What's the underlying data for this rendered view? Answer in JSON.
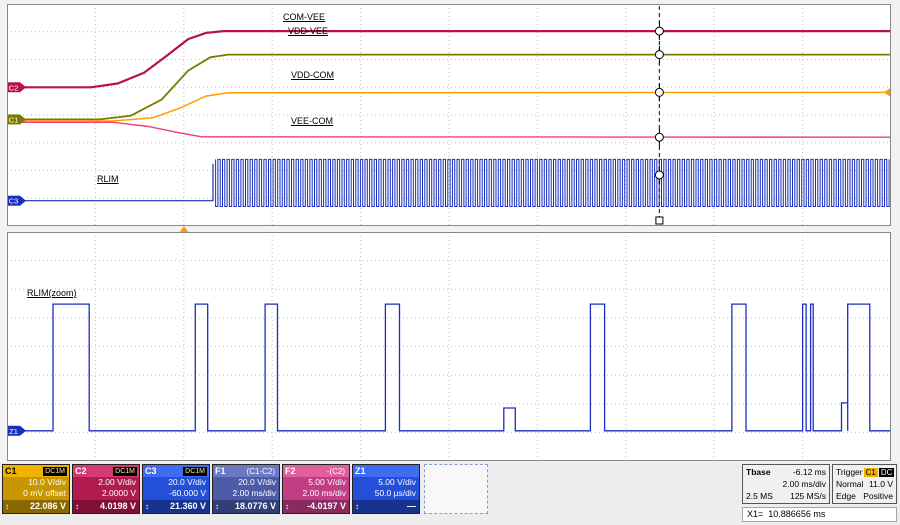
{
  "trace_labels": {
    "top": [
      {
        "text": "COM-VEE",
        "x": 276,
        "y": 8
      },
      {
        "text": "VDD-VEE",
        "x": 281,
        "y": 22
      },
      {
        "text": "VDD-COM",
        "x": 284,
        "y": 66
      },
      {
        "text": "VEE-COM",
        "x": 284,
        "y": 112
      },
      {
        "text": "RLIM",
        "x": 90,
        "y": 170
      }
    ],
    "bottom": [
      {
        "text": "RLIM(zoom)",
        "x": 20,
        "y": 56
      }
    ]
  },
  "chart_data": [
    {
      "type": "line",
      "title": "Main graticule: power rails and RLIM switching",
      "divx": 10,
      "divy": 8,
      "x_units": "time, 2.00 ms/div",
      "trigger_x": 0.2,
      "series": [
        {
          "name": "COM-VEE",
          "color": "#b8124a",
          "width": 2.2,
          "points": [
            [
              0,
              0.375
            ],
            [
              0.095,
              0.375
            ],
            [
              0.125,
              0.358
            ],
            [
              0.155,
              0.31
            ],
            [
              0.18,
              0.235
            ],
            [
              0.205,
              0.158
            ],
            [
              0.225,
              0.13
            ],
            [
              0.245,
              0.122
            ],
            [
              1,
              0.122
            ]
          ]
        },
        {
          "name": "VDD-VEE",
          "color": "#7d7a00",
          "width": 1.8,
          "points": [
            [
              0,
              0.52
            ],
            [
              0.105,
              0.52
            ],
            [
              0.14,
              0.503
            ],
            [
              0.175,
              0.43
            ],
            [
              0.205,
              0.3
            ],
            [
              0.23,
              0.24
            ],
            [
              0.25,
              0.228
            ],
            [
              1,
              0.228
            ]
          ]
        },
        {
          "name": "VDD-COM",
          "color": "#ff9c00",
          "width": 1.5,
          "points": [
            [
              0,
              0.527
            ],
            [
              0.12,
              0.527
            ],
            [
              0.165,
              0.512
            ],
            [
              0.195,
              0.47
            ],
            [
              0.225,
              0.415
            ],
            [
              0.25,
              0.4
            ],
            [
              1,
              0.398
            ]
          ]
        },
        {
          "name": "VEE-COM",
          "color": "#f04070",
          "width": 1.4,
          "points": [
            [
              0,
              0.533
            ],
            [
              0.12,
              0.533
            ],
            [
              0.16,
              0.552
            ],
            [
              0.195,
              0.58
            ],
            [
              0.22,
              0.598
            ],
            [
              1,
              0.6
            ]
          ]
        },
        {
          "name": "RLIM-baseline",
          "color": "#1a2ec0",
          "width": 1.2,
          "points": [
            [
              0,
              0.886
            ],
            [
              0.233,
              0.886
            ],
            [
              0.233,
              0.72
            ]
          ]
        }
      ],
      "pwm": {
        "name": "RLIM",
        "color": "#1a2ec0",
        "x0": 0.236,
        "x1": 1.0,
        "top": 0.7,
        "bottom": 0.912,
        "step": 0.0026
      },
      "cursor": {
        "x": 0.738,
        "color": "#333",
        "markers": [
          0.122,
          0.228,
          0.398,
          0.6,
          0.77
        ],
        "bottom_square": true
      },
      "left_markers": [
        {
          "label": "C2",
          "color": "#b8124a",
          "y": 0.375
        },
        {
          "label": "C1",
          "color": "#7d7a00",
          "y": 0.52
        },
        {
          "label": "C3",
          "color": "#1a2ec0",
          "y": 0.886
        }
      ],
      "right_markers": [
        {
          "label": "",
          "color": "#ff9c00",
          "y": 0.398
        }
      ]
    },
    {
      "type": "pulse",
      "title": "Zoom graticule: RLIM(zoom)",
      "divx": 10,
      "divy": 8,
      "x_units": "time, 50.0 µs/div",
      "color": "#1a2ec0",
      "baseline": 0.868,
      "top": 0.315,
      "pulses": [
        [
          0.052,
          0.093,
          1
        ],
        [
          0.213,
          0.227,
          1
        ],
        [
          0.292,
          0.306,
          1
        ],
        [
          0.428,
          0.444,
          1
        ],
        [
          0.562,
          0.575,
          0.18
        ],
        [
          0.66,
          0.676,
          1
        ],
        [
          0.82,
          0.836,
          1
        ],
        [
          0.9,
          0.904,
          1
        ],
        [
          0.909,
          0.912,
          1
        ],
        [
          0.944,
          0.951,
          0.22
        ],
        [
          0.951,
          0.976,
          1
        ]
      ],
      "left_markers": [
        {
          "label": "Z1",
          "color": "#1a2ec0",
          "y": 0.868
        }
      ]
    }
  ],
  "channels": [
    {
      "id": "C1",
      "badge": "DC1M",
      "badge_chip": true,
      "line1": "10.0 V/div",
      "line2": "0 mV offset",
      "value": "22.086 V",
      "header_bg": "#f2b200",
      "body_bg": "#c89600",
      "value_bg": "#8a6800",
      "header_fg": "#000000"
    },
    {
      "id": "C2",
      "badge": "DC1M",
      "badge_chip": true,
      "line1": "2.00 V/div",
      "line2": "2.0000 V",
      "value": "4.0198 V",
      "header_bg": "#d63a72",
      "body_bg": "#b01c50",
      "value_bg": "#801038",
      "header_fg": "#ffffff"
    },
    {
      "id": "C3",
      "badge": "DC1M",
      "badge_chip": true,
      "line1": "20.0 V/div",
      "line2": "-60.000 V",
      "value": "21.360 V",
      "header_bg": "#3f6df2",
      "body_bg": "#2450d8",
      "value_bg": "#17338f",
      "header_fg": "#ffffff"
    },
    {
      "id": "F1",
      "badge": "(C1-C2)",
      "badge_chip": false,
      "line1": "20.0 V/div",
      "line2": "2.00 ms/div",
      "value": "18.0776 V",
      "header_bg": "#6b79c4",
      "body_bg": "#4d5ba6",
      "value_bg": "#323e77",
      "header_fg": "#ffffff"
    },
    {
      "id": "F2",
      "badge": "-(C2)",
      "badge_chip": false,
      "line1": "5.00 V/div",
      "line2": "2.00 ms/div",
      "value": "-4.0197 V",
      "header_bg": "#e0609e",
      "body_bg": "#c13d85",
      "value_bg": "#8a2a5e",
      "header_fg": "#ffffff"
    },
    {
      "id": "Z1",
      "badge": "",
      "badge_chip": true,
      "line1": "5.00 V/div",
      "line2": "50.0 µs/div",
      "value": "—",
      "header_bg": "#3f6df2",
      "body_bg": "#2450d8",
      "value_bg": "#17338f",
      "header_fg": "#ffffff"
    }
  ],
  "timebase": {
    "label": "Tbase",
    "offset": "-6.12 ms",
    "per_div": "2.00 ms/div",
    "samples": "2.5 MS",
    "rate": "125 MS/s"
  },
  "trigger": {
    "label": "Trigger",
    "source": "C1",
    "coupling": "DC",
    "mode": "Normal",
    "level": "11.0 V",
    "type": "Edge",
    "slope": "Positive"
  },
  "cursor": {
    "label": "X1=",
    "value": "10.886656 ms"
  }
}
